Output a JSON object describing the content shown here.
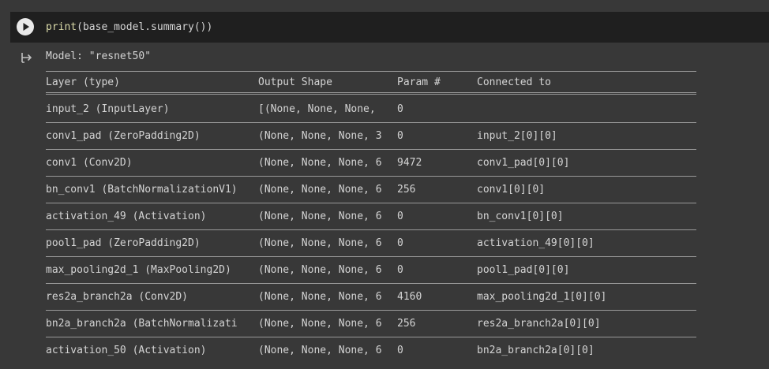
{
  "cell": {
    "code_fn": "print",
    "code_rest": "(base_model.summary())"
  },
  "output": {
    "model_line": "Model: \"resnet50\"",
    "headers": [
      "Layer (type)",
      "Output Shape",
      "Param #",
      "Connected to"
    ],
    "rows": [
      [
        "input_2 (InputLayer)",
        "[(None, None, None,",
        "0",
        ""
      ],
      [
        "conv1_pad (ZeroPadding2D)",
        "(None, None, None, 3",
        "0",
        "input_2[0][0]"
      ],
      [
        "conv1 (Conv2D)",
        "(None, None, None, 6",
        "9472",
        "conv1_pad[0][0]"
      ],
      [
        "bn_conv1 (BatchNormalizationV1)",
        "(None, None, None, 6",
        "256",
        "conv1[0][0]"
      ],
      [
        "activation_49 (Activation)",
        "(None, None, None, 6",
        "0",
        "bn_conv1[0][0]"
      ],
      [
        "pool1_pad (ZeroPadding2D)",
        "(None, None, None, 6",
        "0",
        "activation_49[0][0]"
      ],
      [
        "max_pooling2d_1 (MaxPooling2D)",
        "(None, None, None, 6",
        "0",
        "pool1_pad[0][0]"
      ],
      [
        "res2a_branch2a (Conv2D)",
        "(None, None, None, 6",
        "4160",
        "max_pooling2d_1[0][0]"
      ],
      [
        "bn2a_branch2a (BatchNormalizati",
        "(None, None, None, 6",
        "256",
        "res2a_branch2a[0][0]"
      ],
      [
        "activation_50 (Activation)",
        "(None, None, None, 6",
        "0",
        "bn2a_branch2a[0][0]"
      ]
    ]
  },
  "icons": {
    "run": "play-icon",
    "output": "output-arrow-icon"
  },
  "colors": {
    "background": "#383838",
    "cell_bg": "#1f1f1f",
    "text": "#d4d4d4",
    "function": "#dcdcaa"
  }
}
